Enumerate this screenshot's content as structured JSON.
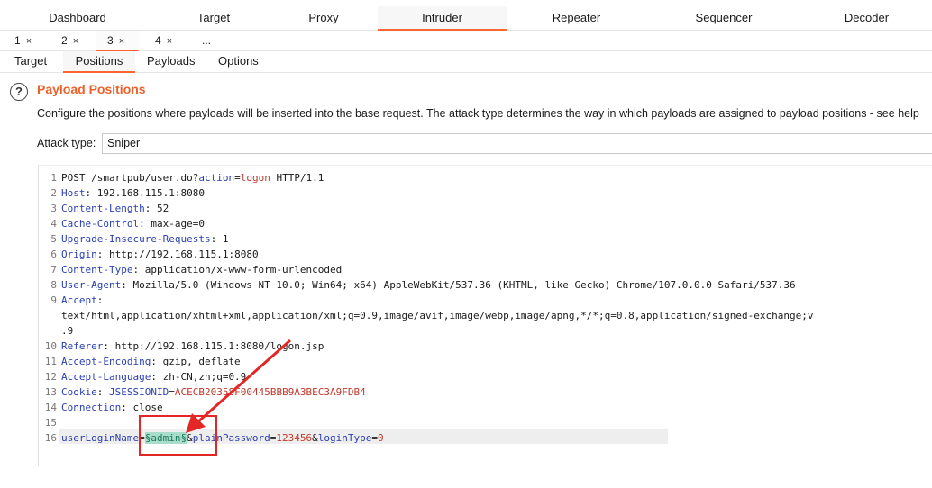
{
  "main_tabs": [
    {
      "label": "Dashboard",
      "active": false
    },
    {
      "label": "Target",
      "active": false
    },
    {
      "label": "Proxy",
      "active": false
    },
    {
      "label": "Intruder",
      "active": true
    },
    {
      "label": "Repeater",
      "active": false
    },
    {
      "label": "Sequencer",
      "active": false
    },
    {
      "label": "Decoder",
      "active": false
    }
  ],
  "attack_tabs": [
    {
      "label": "1",
      "close": "×"
    },
    {
      "label": "2",
      "close": "×"
    },
    {
      "label": "3",
      "close": "×",
      "active": true
    },
    {
      "label": "4",
      "close": "×"
    },
    {
      "label": "..."
    }
  ],
  "config_tabs": [
    {
      "label": "Target"
    },
    {
      "label": "Positions",
      "active": true
    },
    {
      "label": "Payloads"
    },
    {
      "label": "Options"
    }
  ],
  "section": {
    "help_glyph": "?",
    "title": "Payload Positions",
    "description": "Configure the positions where payloads will be inserted into the base request. The attack type determines the way in which payloads are assigned to payload positions - see help"
  },
  "attack_type": {
    "label": "Attack type:",
    "value": "Sniper"
  },
  "request": {
    "line_numbers": [
      "1",
      "2",
      "3",
      "4",
      "5",
      "6",
      "7",
      "8",
      "9",
      "",
      "",
      "10",
      "11",
      "12",
      "13",
      "14",
      "15",
      "16"
    ],
    "request_line": {
      "prefix": "POST /smartpub/user.do?",
      "param": "action",
      "eq": "=",
      "value": "logon",
      "suffix": " HTTP/1.1"
    },
    "headers": [
      {
        "name": "Host",
        "value": " 192.168.115.1:8080"
      },
      {
        "name": "Content-Length",
        "value": " 52"
      },
      {
        "name": "Cache-Control",
        "value": " max-age=0"
      },
      {
        "name": "Upgrade-Insecure-Requests",
        "value": " 1"
      },
      {
        "name": "Origin",
        "value": " http://192.168.115.1:8080"
      },
      {
        "name": "Content-Type",
        "value": " application/x-www-form-urlencoded"
      },
      {
        "name": "User-Agent",
        "value": " Mozilla/5.0 (Windows NT 10.0; Win64; x64) AppleWebKit/537.36 (KHTML, like Gecko) Chrome/107.0.0.0 Safari/537.36"
      },
      {
        "name": "Accept",
        "value": ""
      }
    ],
    "accept_cont_1": "text/html,application/xhtml+xml,application/xml;q=0.9,image/avif,image/webp,image/apng,*/*;q=0.8,application/signed-exchange;v",
    "accept_cont_2": ".9",
    "headers2": [
      {
        "name": "Referer",
        "value": " http://192.168.115.1:8080/logon.jsp"
      },
      {
        "name": "Accept-Encoding",
        "value": " gzip, deflate"
      },
      {
        "name": "Accept-Language",
        "value": " zh-CN,zh;q=0.9"
      }
    ],
    "cookie": {
      "name": "Cookie",
      "param": "JSESSIONID",
      "value": "ACECB20358F00445BBB9A3BEC3A9FDB4"
    },
    "connection": {
      "name": "Connection",
      "value": " close"
    },
    "body": {
      "p1": "userLoginName",
      "p1_value": "§admin§",
      "p2": "plainPassword",
      "p2_value": "123456",
      "p3": "loginType",
      "p3_value": "0",
      "eq": "=",
      "amp": "&"
    }
  },
  "colors": {
    "accent": "#ff6633",
    "title": "#e8622c",
    "header_key": "#2a3fb3",
    "param_value": "#c0392b",
    "payload_bg": "#a8dccb",
    "annotation": "#e32727"
  }
}
